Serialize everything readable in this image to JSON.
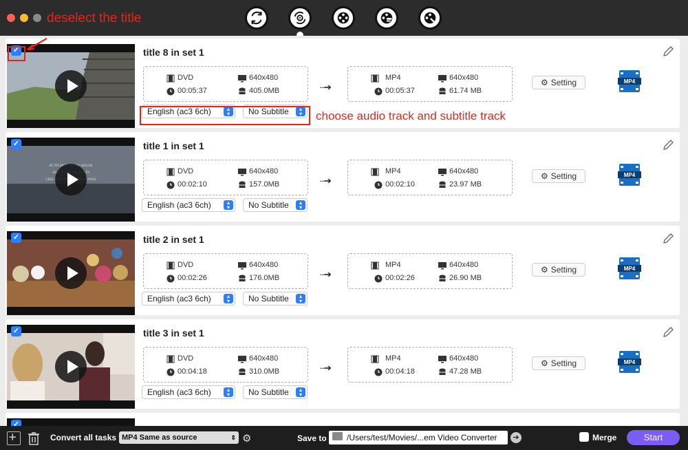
{
  "toolbar": {
    "icons": [
      "convert-icon",
      "dvd-convert-icon",
      "film-reel-icon",
      "film-edit-icon",
      "film-search-icon"
    ]
  },
  "annotations": {
    "deselect": "deselect the title",
    "choose_tracks": "choose audio track and subtitle track",
    "color": "#e0271b"
  },
  "rows": [
    {
      "title": "title 8 in set 1",
      "src_format": "DVD",
      "src_res": "640x480",
      "src_duration": "00:05:37",
      "src_size": "405.0MB",
      "dst_format": "MP4",
      "dst_res": "640x480",
      "dst_duration": "00:05:37",
      "dst_size": "61.74 MB",
      "audio": "English (ac3 6ch)",
      "subtitle": "No Subtitle",
      "setting_label": "Setting",
      "checked": true
    },
    {
      "title": "title 1 in set 1",
      "src_format": "DVD",
      "src_res": "640x480",
      "src_duration": "00:02:10",
      "src_size": "157.0MB",
      "dst_format": "MP4",
      "dst_res": "640x480",
      "dst_duration": "00:02:10",
      "dst_size": "23.97 MB",
      "audio": "English (ac3 6ch)",
      "subtitle": "No Subtitle",
      "setting_label": "Setting",
      "checked": true
    },
    {
      "title": "title 2 in set 1",
      "src_format": "DVD",
      "src_res": "640x480",
      "src_duration": "00:02:26",
      "src_size": "176.0MB",
      "dst_format": "MP4",
      "dst_res": "640x480",
      "dst_duration": "00:02:26",
      "dst_size": "26.90 MB",
      "audio": "English (ac3 6ch)",
      "subtitle": "No Subtitle",
      "setting_label": "Setting",
      "checked": true
    },
    {
      "title": "title 3 in set 1",
      "src_format": "DVD",
      "src_res": "640x480",
      "src_duration": "00:04:18",
      "src_size": "310.0MB",
      "dst_format": "MP4",
      "dst_res": "640x480",
      "dst_duration": "00:04:18",
      "dst_size": "47.28 MB",
      "audio": "English (ac3 6ch)",
      "subtitle": "No Subtitle",
      "setting_label": "Setting",
      "checked": true
    }
  ],
  "thumb_text": {
    "row1_line1": "AT ITS MOST BASIC HOUSE",
    "row1_line2": "AS A PLACE WE ARE IN",
    "row1_line3": "LIKE A CASTLE OF THE SENSES",
    "row1_line4": "PULL"
  },
  "bottom": {
    "convert_label": "Convert all tasks to",
    "format_value": "MP4 Same as source",
    "saveto_label": "Save to",
    "path_value": "/Users/test/Movies/...em Video Converter",
    "merge_label": "Merge",
    "start_label": "Start"
  },
  "colors": {
    "accent": "#2d7ff9",
    "start": "#7b5cf5"
  }
}
